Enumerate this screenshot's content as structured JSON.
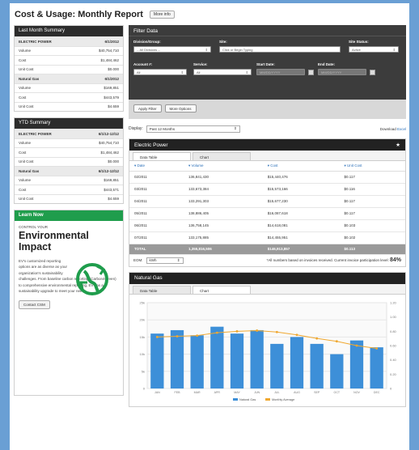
{
  "header": {
    "title": "Cost & Usage: Monthly Report",
    "more_info": "More info"
  },
  "last_month": {
    "title": "Last Month Summary",
    "rows": [
      {
        "label": "ELECTRIC POWER",
        "value": "6/1/2012",
        "section": true
      },
      {
        "label": "Volume",
        "value": "$40,754,710"
      },
      {
        "label": "Cost",
        "value": "$1,484,462"
      },
      {
        "label": "Unit Cost",
        "value": "$0.000"
      },
      {
        "label": "Natural Gas",
        "value": "6/1/2012",
        "section": true
      },
      {
        "label": "Volume",
        "value": "$169,851"
      },
      {
        "label": "Cost",
        "value": "$443,579"
      },
      {
        "label": "Unit Cost",
        "value": "$4.659"
      }
    ]
  },
  "ytd": {
    "title": "YTD Summary",
    "rows": [
      {
        "label": "ELECTRIC POWER",
        "value": "6/1/12-12/12",
        "section": true
      },
      {
        "label": "Volume",
        "value": "$40,754,710"
      },
      {
        "label": "Cost",
        "value": "$1,484,462"
      },
      {
        "label": "Unit Cost",
        "value": "$0.000"
      },
      {
        "label": "Natural Gas",
        "value": "6/1/12-12/12",
        "section": true
      },
      {
        "label": "Volume",
        "value": "$169,851"
      },
      {
        "label": "Cost",
        "value": "$443,571"
      },
      {
        "label": "Unit Cost",
        "value": "$4.659"
      }
    ]
  },
  "learn": {
    "title": "Learn Now",
    "small": "CONTROL YOUR",
    "big1": "Environmental",
    "big2": "Impact",
    "text1": "EV's customized reporting options are as diverse as your organization's sustainability",
    "text2": "challenges. From baseline carbon reporting (Carbon4Green) to comprehensive environmental reporting, EV has a sustainability upgrade to meet your needs.",
    "contact": "Contact CSM"
  },
  "filter": {
    "title": "Filter Data",
    "division_label": "Division/Group:",
    "division_value": "-- All Divisions --",
    "site_label": "Site:",
    "site_value": "Click or Begin Typing",
    "site_status_label": "Site Status:",
    "site_status_value": "Active",
    "account_label": "Account #:",
    "account_value": "All",
    "service_label": "Service:",
    "service_value": "All",
    "start_label": "Start Date:",
    "start_placeholder": "MM/DD/YYYY",
    "end_label": "End Date:",
    "end_placeholder": "MM/DD/YYYY",
    "apply": "Apply Filter",
    "more_options": "More Options"
  },
  "display": {
    "label": "Display:",
    "value": "Past 12 Months",
    "download": "Download",
    "download_type": "Excel"
  },
  "electric": {
    "title": "Electric Power",
    "tabs": [
      "Data Table",
      "Chart"
    ],
    "columns": [
      "Date",
      "Volume",
      "Cost",
      "Unit Cost"
    ],
    "rows": [
      [
        "02/2011",
        "136,841,430",
        "$15,440,476",
        "$0.117"
      ],
      [
        "03/2011",
        "133,673,384",
        "$15,573,166",
        "$0.116"
      ],
      [
        "04/2011",
        "133,291,303",
        "$15,677,230",
        "$0.117"
      ],
      [
        "05/2011",
        "138,886,405",
        "$16,087,618",
        "$0.117"
      ],
      [
        "06/2011",
        "136,758,145",
        "$14,618,081",
        "$0.103"
      ],
      [
        "07/2011",
        "133,175,885",
        "$14,455,951",
        "$0.102"
      ]
    ],
    "total": [
      "TOTAL",
      "1,355,816,506",
      "$146,913,857",
      "$0.113"
    ],
    "unit_label": "EOM:",
    "unit_value": "kWh",
    "note": "*All numbers based on invoices received. Current invoice participation level:",
    "participation": "84%"
  },
  "gas": {
    "title": "Natural Gas",
    "tabs": [
      "Data Table",
      "Chart"
    ]
  },
  "chart_data": {
    "type": "bar",
    "categories": [
      "JAN",
      "FEB",
      "MAR",
      "APR",
      "MAY",
      "JUN",
      "JUL",
      "AUG",
      "SEP",
      "OCT",
      "NOV",
      "DEC"
    ],
    "ylim": [
      0,
      25
    ],
    "y2lim": [
      0,
      1.2
    ],
    "yticks": [
      "25k",
      "20k",
      "15k",
      "10k",
      "5k",
      "0"
    ],
    "y2ticks": [
      "1.20",
      "1.00",
      "0.80",
      "0.60",
      "0.40",
      "0.20",
      "0"
    ],
    "series": [
      {
        "name": "Natural Gas",
        "type": "bar",
        "color": "#3d8fd8",
        "values": [
          16,
          17,
          15.5,
          18,
          16,
          17,
          13,
          15,
          13,
          10,
          14,
          12
        ]
      },
      {
        "name": "Monthly Average",
        "type": "line",
        "axis": "right",
        "color": "#f0a830",
        "values": [
          0.72,
          0.73,
          0.74,
          0.78,
          0.8,
          0.81,
          0.79,
          0.75,
          0.7,
          0.66,
          0.6,
          0.56
        ]
      }
    ]
  }
}
